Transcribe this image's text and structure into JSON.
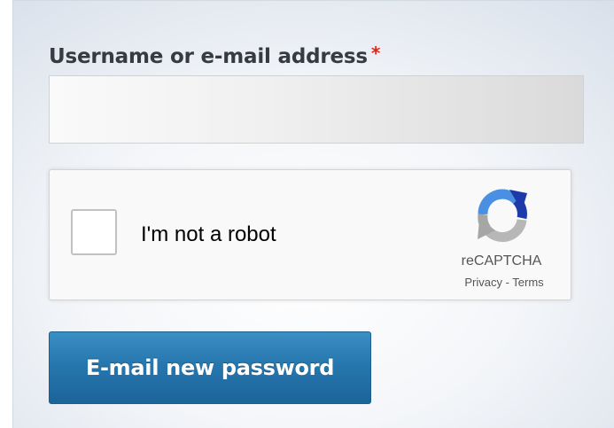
{
  "form": {
    "username_label": "Username or e-mail address",
    "required_marker": "*",
    "username_value": "",
    "submit_label": "E-mail new password"
  },
  "recaptcha": {
    "checkbox_label": "I'm not a robot",
    "checked": false,
    "brand": "reCAPTCHA",
    "privacy_link": "Privacy",
    "separator": " - ",
    "terms_link": "Terms",
    "logo_icon": "recaptcha-logo-icon"
  },
  "colors": {
    "required": "#e2231a",
    "button": "#2677ae",
    "label": "#353b41"
  }
}
